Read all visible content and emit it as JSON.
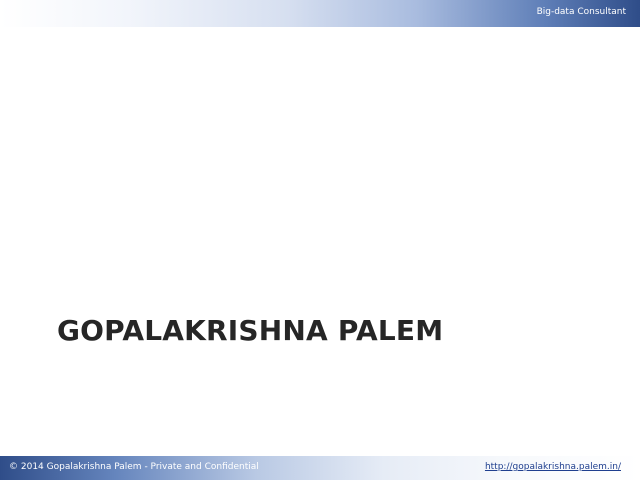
{
  "header": {
    "tagline": "Big-data Consultant"
  },
  "slide": {
    "title": "GOPALAKRISHNA PALEM"
  },
  "footer": {
    "copyright": "© 2014 Gopalakrishna Palem - Private and Confidential",
    "url": "http://gopalakrishna.palem.in/"
  },
  "colors": {
    "band_dark": "#2f4d89",
    "title_text": "#262626",
    "link": "#1f3f8f"
  }
}
